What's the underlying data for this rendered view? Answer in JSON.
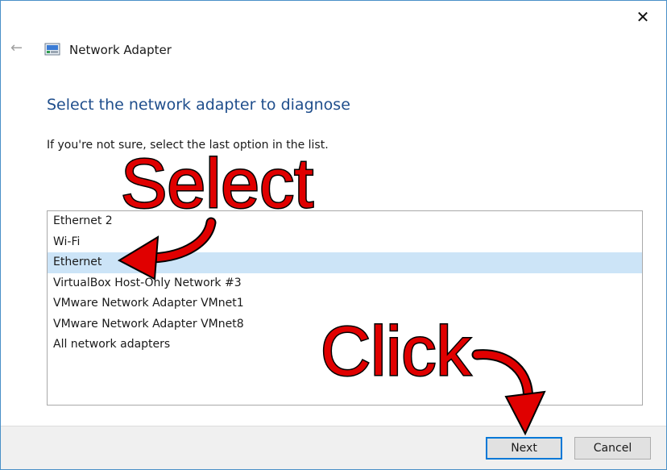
{
  "window": {
    "close_glyph": "✕",
    "back_glyph": "←",
    "title": "Network Adapter"
  },
  "main": {
    "heading": "Select the network adapter to diagnose",
    "hint": "If you're not sure, select the last option in the list."
  },
  "adapters": [
    {
      "label": "Ethernet 2",
      "selected": false
    },
    {
      "label": "Wi-Fi",
      "selected": false
    },
    {
      "label": "Ethernet",
      "selected": true
    },
    {
      "label": "VirtualBox Host-Only Network #3",
      "selected": false
    },
    {
      "label": "VMware Network Adapter VMnet1",
      "selected": false
    },
    {
      "label": "VMware Network Adapter VMnet8",
      "selected": false
    },
    {
      "label": "All network adapters",
      "selected": false
    }
  ],
  "footer": {
    "next_label": "Next",
    "cancel_label": "Cancel"
  },
  "annotations": {
    "select_text": "Select",
    "click_text": "Click",
    "color": "#e00000"
  },
  "colors": {
    "selection": "#cce4f7",
    "heading": "#1f4e8c",
    "accent": "#0078d7"
  }
}
